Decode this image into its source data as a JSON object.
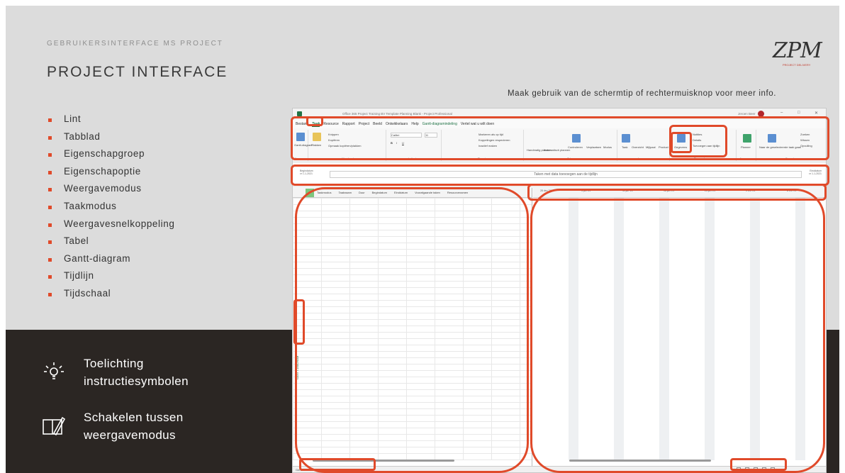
{
  "header": {
    "subtitle": "GEBRUIKERSINTERFACE MS PROJECT",
    "title": "PROJECT INTERFACE",
    "tip": "Maak gebruik van de schermtip of rechtermuisknop voor meer info."
  },
  "logo": {
    "mark": "ZPM",
    "tagline": "PROJECT DELIVERY"
  },
  "bullets": [
    "Lint",
    "Tabblad",
    "Eigenschapgroep",
    "Eigenschapoptie",
    "Weergavemodus",
    "Taakmodus",
    "Weergavesnelkoppeling",
    "Tabel",
    "Gantt-diagram",
    "Tijdlijn",
    "Tijdschaal"
  ],
  "legend": [
    {
      "icon": "lightbulb-icon",
      "text": "Toelichting\ninstructiesymbolen"
    },
    {
      "icon": "edit-document-icon",
      "text": "Schakelen tussen\nweergavemodus"
    }
  ],
  "app": {
    "window_title": "Office 365 Project Training BV Template Planning Blank - Project Professional",
    "user": "Jeroen Beer",
    "menu": [
      "Bestand",
      "Taak",
      "Resource",
      "Rapport",
      "Project",
      "Beeld",
      "Ontwikkelaars",
      "Help",
      "Gantt-diagramindeling",
      "Vertel wat u wilt doen"
    ],
    "active_menu": "Taak",
    "ribbon_groups": [
      "Weergave",
      "Klembord",
      "Lettertype",
      "Planning",
      "Taken",
      "Invoegen",
      "Eigenschappen",
      "Apps van...",
      "Bewerken"
    ],
    "ribbon_labels": {
      "gantt": "Gantt-diagram",
      "paste": "Plakken",
      "cut": "Knippen",
      "copy": "Kopiëren",
      "format_painter": "Opmaak kopiëren/plakken",
      "font": "Calibri",
      "font_size": "11",
      "mark_on_track": "Markeren als op tijd",
      "respect_links": "Koppelingen respecteren",
      "inactivate": "Inactief maken",
      "manual": "Handmatig plannen",
      "auto": "Automatisch plannen",
      "inspect": "Controleren",
      "move": "Verplaatsen",
      "mode": "Modus",
      "task": "Taak",
      "summary": "Overzicht",
      "milestone": "Mijlpaal",
      "deliverable": "Product",
      "information": "Gegevens",
      "notes": "Notities",
      "details": "Details",
      "add_to_timeline": "Toevoegen aan tijdlijn",
      "planner": "Planner",
      "scroll_to_task": "Naar de geselecteerde taak gaan",
      "find": "Zoeken",
      "clear": "Wissen",
      "fill": "Opvulling"
    },
    "timeline": {
      "label": "Tijdlijn",
      "start_label": "Begindatum",
      "start_value": "vr 1-1-2021",
      "placeholder": "Taken met data toevoegen aan de tijdlijn",
      "end_label": "Einddatum",
      "end_value": "vr 1-1-2021"
    },
    "table_columns": [
      "Taakmodus",
      "Taaknaam",
      "Duur",
      "Begindatum",
      "Einddatum",
      "Voorafgaande taken",
      "Resourcenamen"
    ],
    "gantt_dates": [
      "28 dec '20",
      "4 jan '21",
      "11 jan '21",
      "18 jan '21",
      "25 jan '21",
      "1 feb '21",
      "8 feb '21"
    ],
    "side_label": "GANTT-DIAGRAM",
    "status": {
      "ready": "Gereed",
      "task_mode": "Nieuwe taken: Handmatig gepland"
    }
  }
}
